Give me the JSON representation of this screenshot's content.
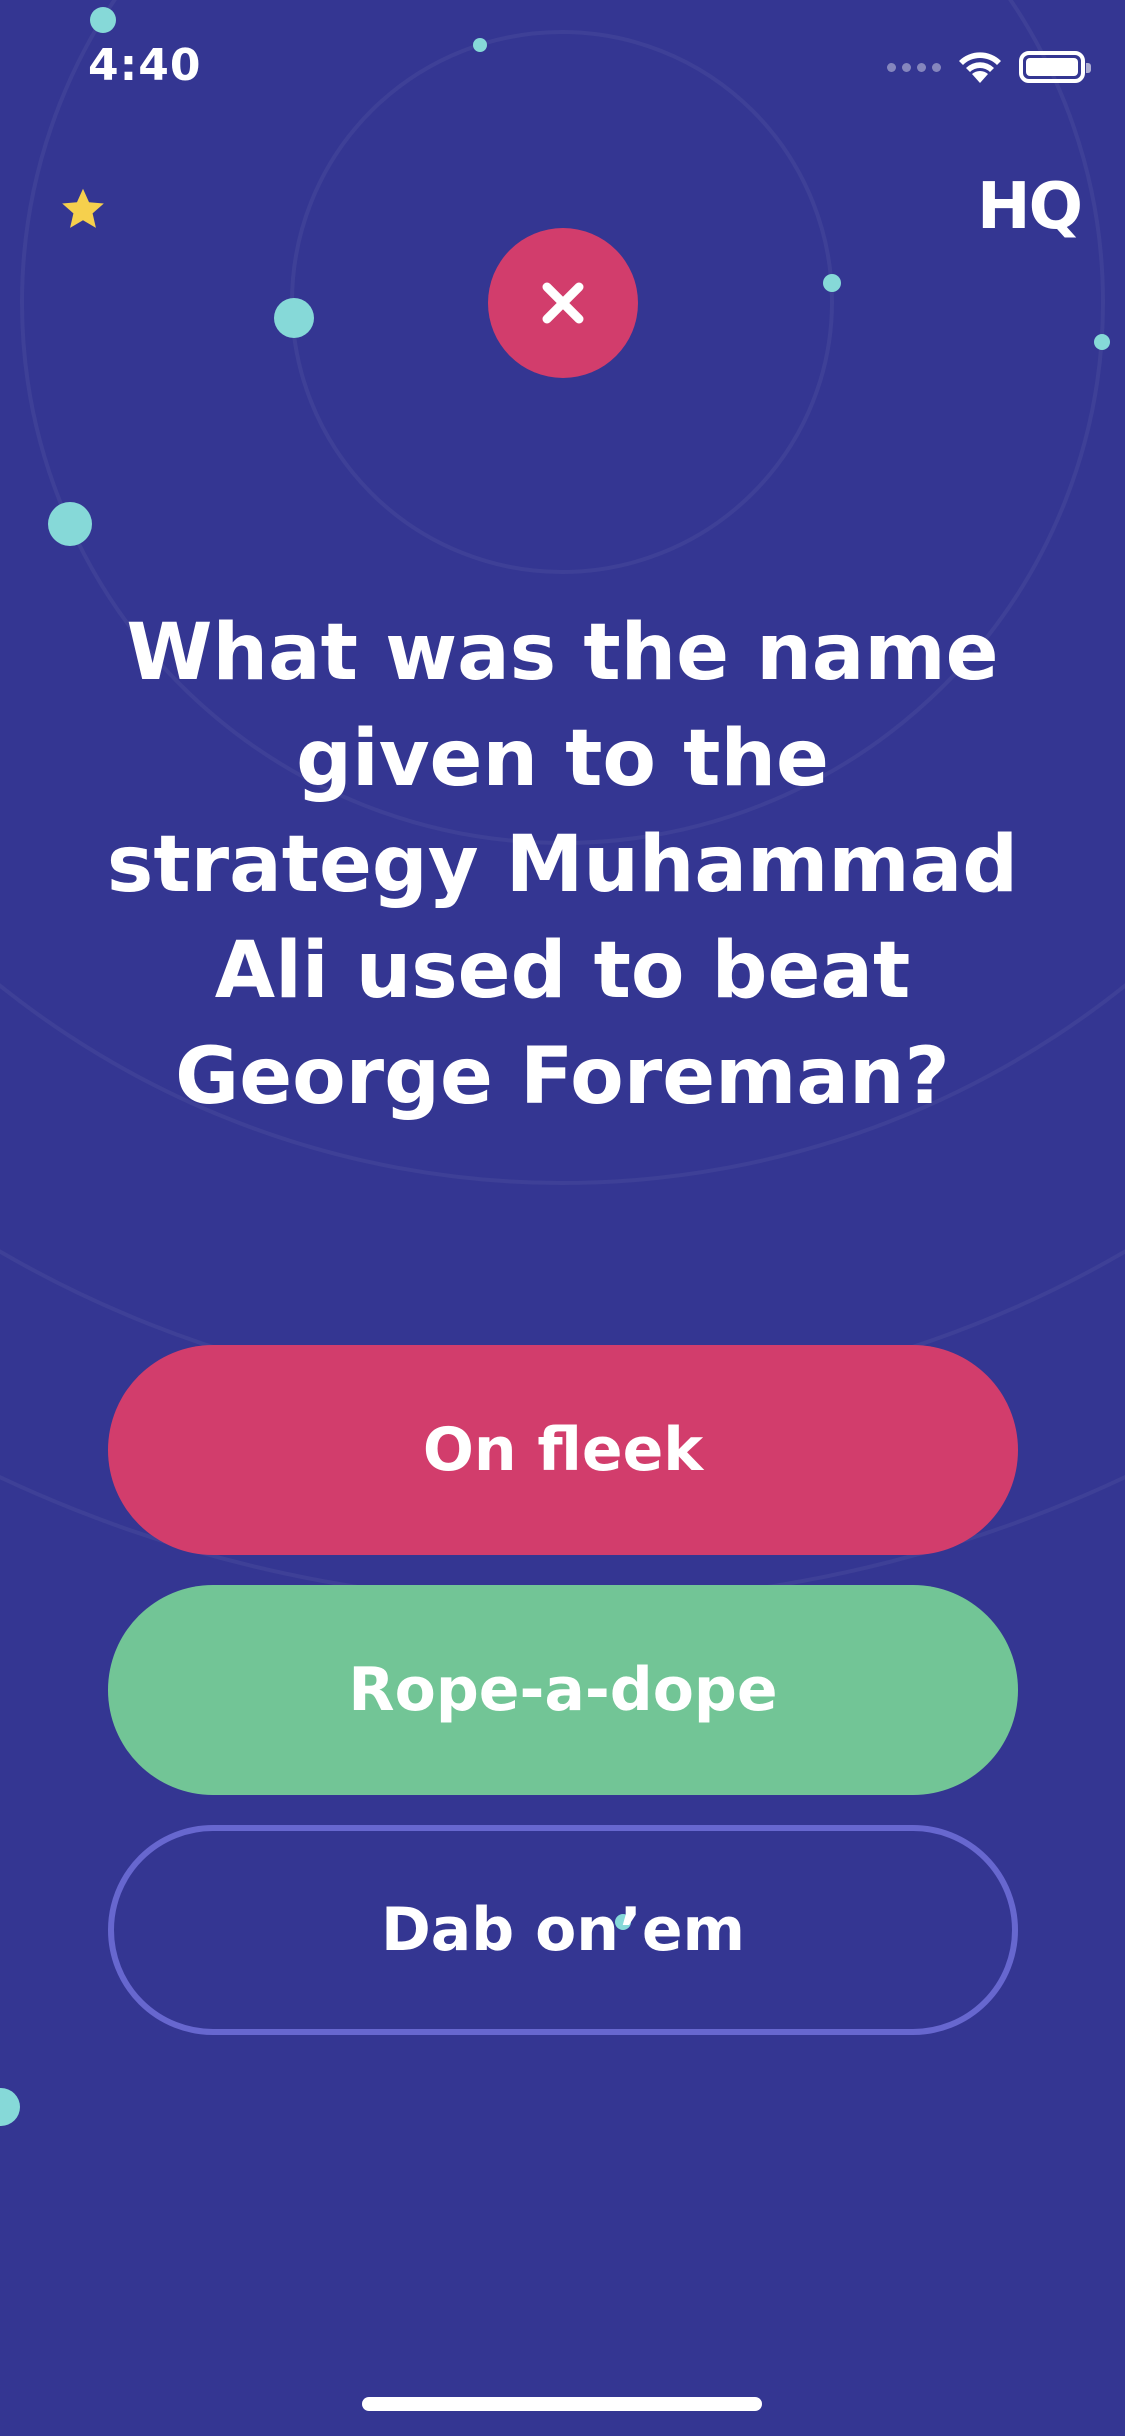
{
  "status_bar": {
    "time": "4:40"
  },
  "header": {
    "logo_text": "HQ",
    "star_icon": "star-icon",
    "result_icon": "close-icon"
  },
  "question": {
    "text": "What was the name given to the strategy Muhammad Ali used to beat George Foreman?"
  },
  "answers": [
    {
      "label": "On fleek",
      "state": "wrong"
    },
    {
      "label": "Rope-a-dope",
      "state": "correct"
    },
    {
      "label": "Dab on’em",
      "state": "unselected"
    }
  ],
  "colors": {
    "background": "#343692",
    "wrong": "#d23d6c",
    "correct": "#72c596",
    "outline": "#6767cf",
    "accent_dot": "#86d9d8",
    "star": "#f6d04d"
  }
}
